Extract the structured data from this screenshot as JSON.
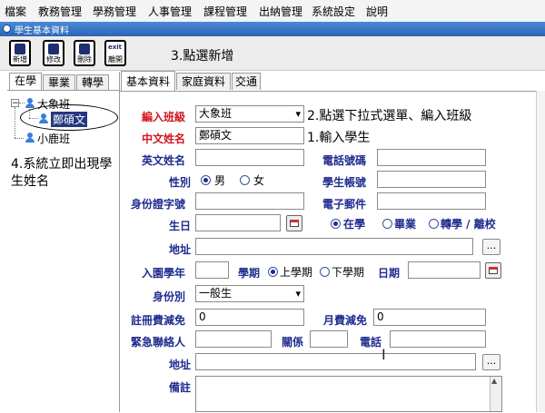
{
  "menu": [
    "檔案",
    "教務管理",
    "學務管理",
    "人事管理",
    "課程管理",
    "出納管理",
    "系統設定",
    "說明"
  ],
  "window_title": "學生基本資料",
  "toolbar": {
    "buttons": [
      {
        "label": "新增",
        "icon": "add-icon"
      },
      {
        "label": "修改",
        "icon": "edit-icon"
      },
      {
        "label": "刪除",
        "icon": "delete-icon"
      },
      {
        "label": "離開",
        "icon": "exit-icon",
        "caption": "exit"
      }
    ],
    "instruction": "3.點選新增"
  },
  "left_tabs": [
    "在學",
    "畢業",
    "轉學"
  ],
  "tree": {
    "class1": "大象班",
    "student1": "鄭碩文",
    "class2": "小鹿班"
  },
  "left_note": "4.系統立即出現學生姓名",
  "main_tabs": [
    "基本資料",
    "家庭資料",
    "交通"
  ],
  "form": {
    "class_label": "編入班級",
    "class_value": "大象班",
    "class_instruction": "2.點選下拉式選單、編入班級",
    "name_label": "中文姓名",
    "name_value": "鄭碩文",
    "name_instruction": "1.輸入學生",
    "english_name_label": "英文姓名",
    "phone_label": "電話號碼",
    "gender_label": "性別",
    "gender_male": "男",
    "gender_female": "女",
    "account_label": "學生帳號",
    "id_label": "身份證字號",
    "email_label": "電子郵件",
    "birthday_label": "生日",
    "status_enrolled": "在學",
    "status_graduated": "畢業",
    "status_transfer": "轉學 / 離校",
    "address_label": "地址",
    "browse": "...",
    "entry_year_label": "入園學年",
    "semester_label": "學期",
    "semester_first": "上學期",
    "semester_second": "下學期",
    "date_label": "日期",
    "identity_label": "身份別",
    "identity_value": "一般生",
    "reg_discount_label": "註冊費減免",
    "reg_discount_value": "0",
    "monthly_discount_label": "月費減免",
    "monthly_discount_value": "0",
    "emergency_label": "緊急聯絡人",
    "relation_label": "關係",
    "tel_label": "電話",
    "address2_label": "地址",
    "remarks_label": "備註"
  },
  "colors": {
    "label_blue": "#1f2b8f",
    "label_red": "#d2141e",
    "titlebar": "#2c64b3",
    "selected": "#24387f"
  }
}
